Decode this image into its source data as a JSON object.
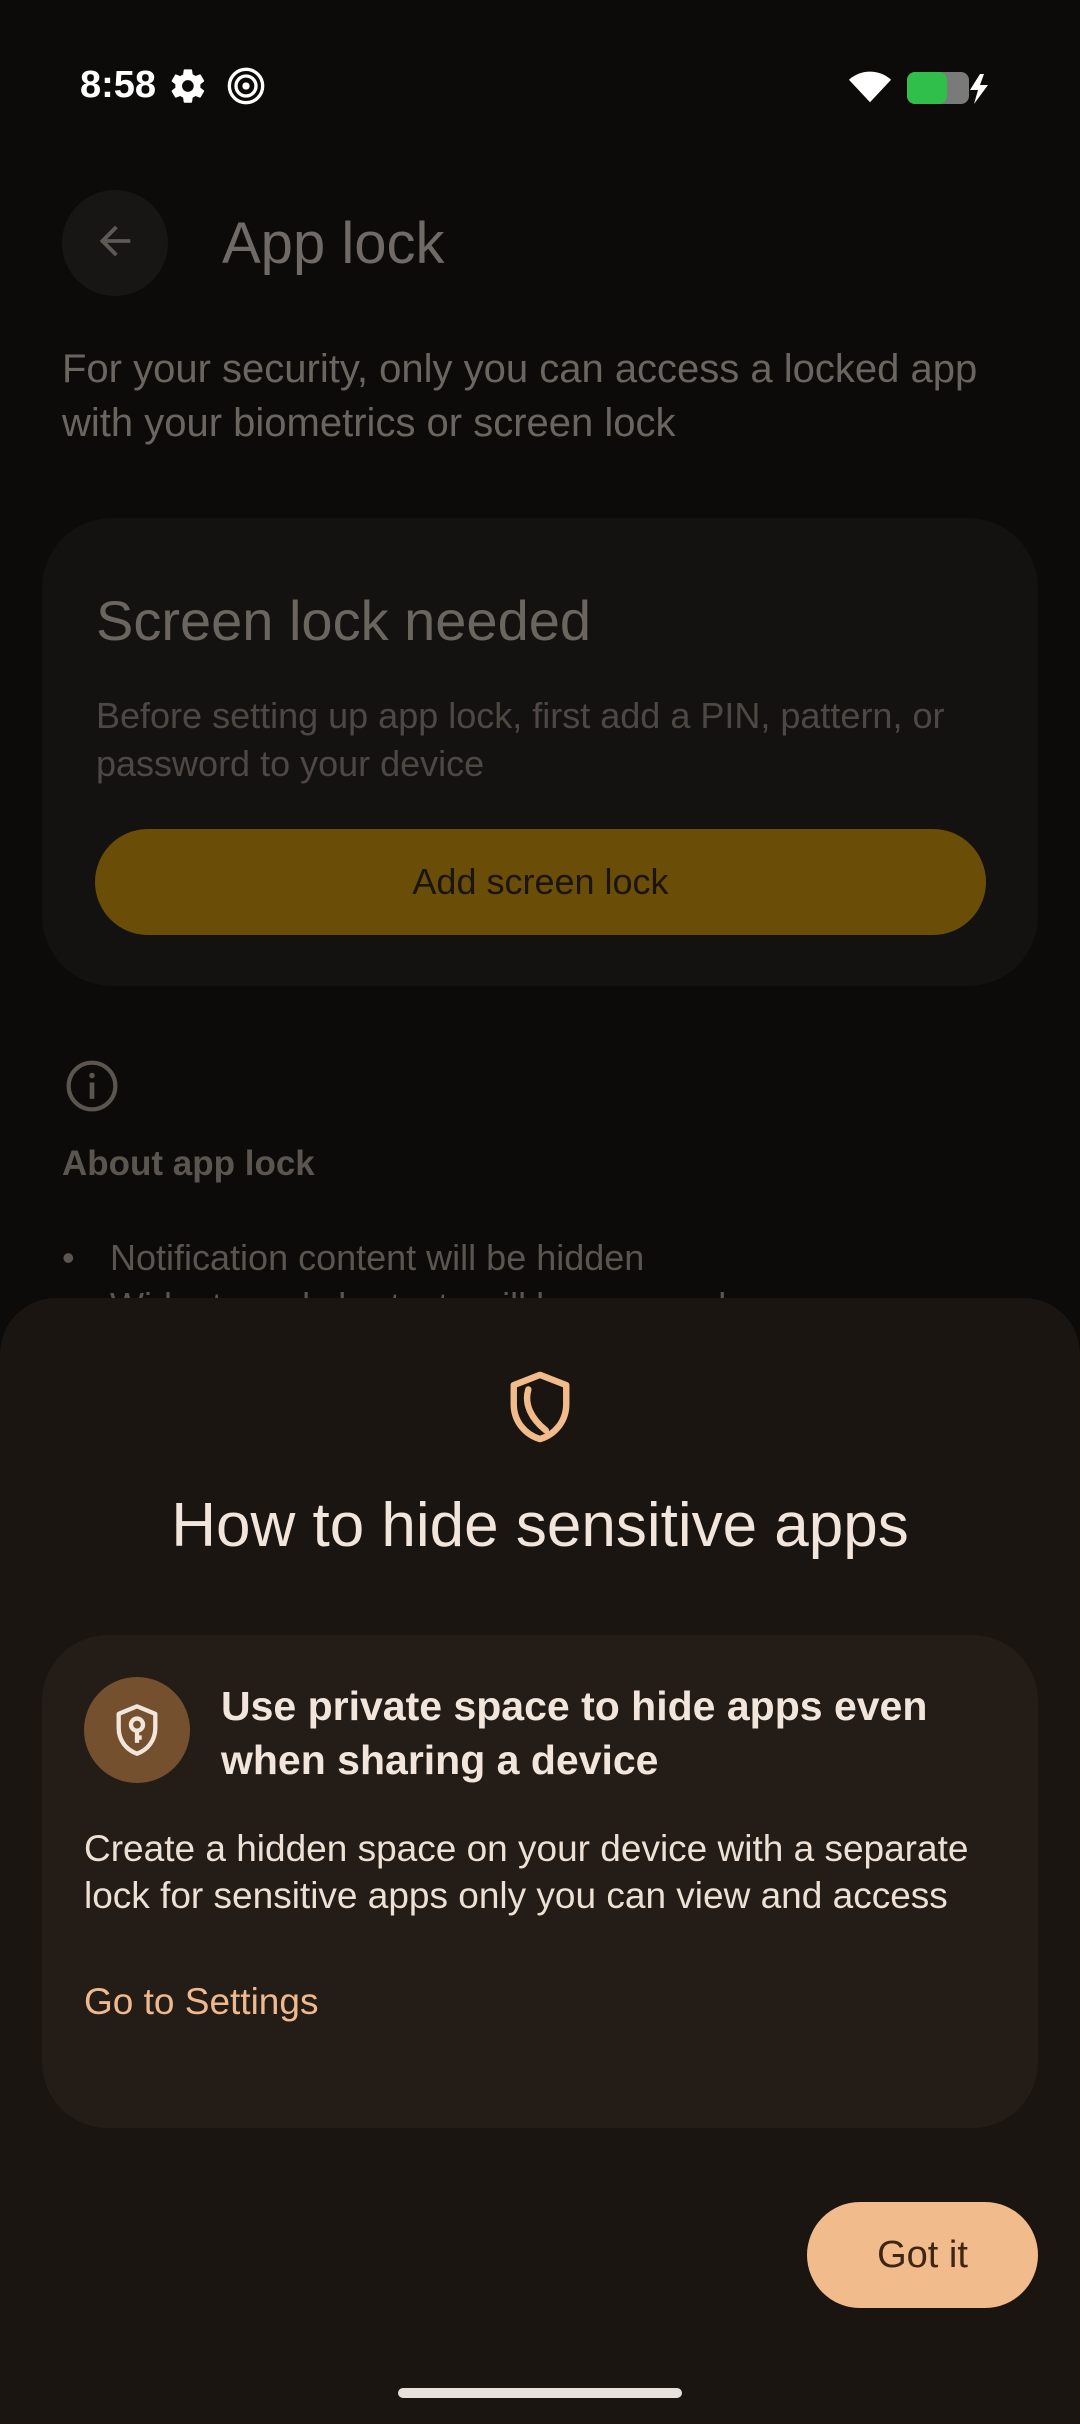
{
  "status_bar": {
    "time": "8:58",
    "icons": [
      "gear-icon",
      "spiral-icon",
      "wifi-icon",
      "battery-charging-icon"
    ],
    "battery_color": "#2fbf4a"
  },
  "app_bar": {
    "title": "App lock",
    "back_icon": "arrow-left-icon"
  },
  "page": {
    "description": "For your security, only you can access a locked app with your biometrics or screen lock"
  },
  "screen_lock_card": {
    "title": "Screen lock needed",
    "description": "Before setting up app lock, first add a PIN, pattern, or password to your device",
    "button_label": "Add screen lock",
    "button_color": "#6a4d06"
  },
  "about": {
    "icon": "info-icon",
    "title": "About app lock",
    "items": [
      "Notification content will be hidden",
      "Widgets and shortcuts will be removed"
    ]
  },
  "bottom_sheet": {
    "icon": "shield-icon",
    "title": "How to hide sensitive apps",
    "private_space_card": {
      "icon": "lock-shield-icon",
      "title": "Use private space to hide apps even when sharing a device",
      "description": "Create a hidden space on your device with a separate lock for sensitive apps only you can view and access",
      "link_label": "Go to Settings"
    },
    "confirm_button_label": "Got it",
    "accent_color": "#f2bb8b"
  }
}
